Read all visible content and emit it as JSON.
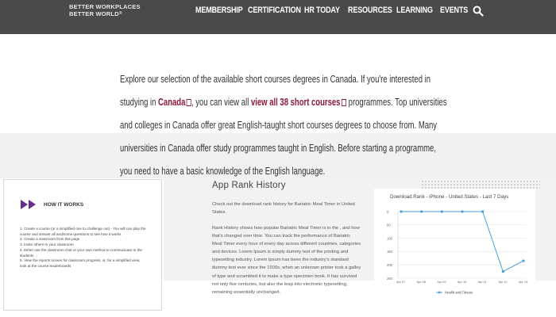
{
  "logo": {
    "line1": "BETTER WORKPLACES",
    "line2": "BETTER WORLD",
    "tm": "®"
  },
  "nav": {
    "items": [
      "MEMBERSHIP",
      "CERTIFICATION",
      "HR TODAY",
      "RESOURCES",
      "LEARNING",
      "EVENTS"
    ],
    "search_icon": "search-icon"
  },
  "intro": {
    "text1": "Explore our selection of the available short courses degrees in Canada. If you're interested in studying in ",
    "link1": "Canada",
    "text2": ", you can view all ",
    "link2": "view all 38 short courses",
    "text3": " programmes. Top universities and colleges in Canada offer great English-taught short courses degrees to choose from. Many universities in Canada offer study programmes taught in English. Before starting a programme, you need to have a basic knowledge of the English language."
  },
  "how_it_works": {
    "title": "HOW IT WORKS",
    "steps": [
      "1. Create a course (or a simplified one to challenge out) - You will can play the",
      "   course and answer all and/some questions to see how it works",
      "2. Create a classroom from this page",
      "3. Invite others to your classroom",
      "4. Either use the classroom chat or your own method to communicate to the",
      "   students",
      "5. View the reports screen for classroom progress, or, for a simplified view,",
      "   look at the course leaderboards"
    ]
  },
  "app_rank": {
    "title": "App Rank History",
    "subtitle": "Check out the download rank history for Bariatric Meal Timer in United States.",
    "body": "Rank History shows how popular Bariatric Meal Timer is in the , and how that's changed over time. You can track the performance of Bariatric Meal Timer every hour of every day across different countries, categories and devices. Lorem Ipsum is simply dummy text of the printing and typesetting industry. Lorem Ipsum has been the industry's standard dummy text ever since the 1500s, when an unknown printer took a galley of type and scrambled it to make a type specimen book. It has survived not only five centuries, but also the leap into electronic typesetting, remaining essentially unchanged."
  },
  "chart_data": {
    "type": "line",
    "title": "Download Rank - iPhone - United States - Last 7 Days",
    "x": [
      "Apr 07",
      "Apr 08",
      "Apr 09",
      "Apr 10",
      "Apr 11",
      "Apr 12",
      "Apr 13"
    ],
    "y_ticks": [
      "0",
      "50",
      "100",
      "150",
      "200",
      "250"
    ],
    "ylim": [
      0,
      250
    ],
    "y_inverted": true,
    "series": [
      {
        "name": "Health and Fitness",
        "values": [
          0,
          0,
          0,
          0,
          0,
          225,
          185
        ],
        "color": "#4a9fd8"
      }
    ],
    "legend": "bottom"
  }
}
